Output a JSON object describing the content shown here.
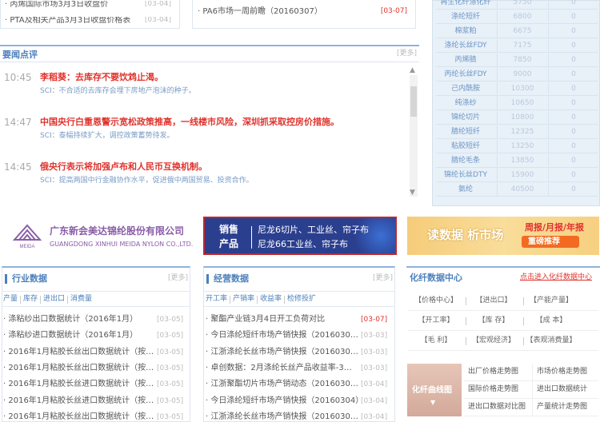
{
  "top_left_list": [
    {
      "text": "丙烯国际市场3月3日收盘价",
      "date": "[03-04]"
    },
    {
      "text": "PTA及相关产品3月3日收盘价格表",
      "date": "[03-04]"
    }
  ],
  "top_mid_list": [
    {
      "text": "PA6市场一周前瞻（20160307）",
      "date": "[03-07]"
    }
  ],
  "price_table": [
    {
      "name": "再生化纤涤化纤",
      "p": "5750",
      "c": "0"
    },
    {
      "name": "涤纶短纤",
      "p": "6800",
      "c": "0"
    },
    {
      "name": "棉浆粕",
      "p": "6675",
      "c": "0"
    },
    {
      "name": "涤纶长丝FDY",
      "p": "7175",
      "c": "0"
    },
    {
      "name": "丙烯腈",
      "p": "7850",
      "c": "0"
    },
    {
      "name": "丙纶长丝FDY",
      "p": "9000",
      "c": "0"
    },
    {
      "name": "己内酰胺",
      "p": "10300",
      "c": "0"
    },
    {
      "name": "纯涤纱",
      "p": "10650",
      "c": "0"
    },
    {
      "name": "锦纶切片",
      "p": "10800",
      "c": "0"
    },
    {
      "name": "腈纶短纤",
      "p": "12325",
      "c": "0"
    },
    {
      "name": "粘胶短纤",
      "p": "13250",
      "c": "0"
    },
    {
      "name": "腈纶毛条",
      "p": "13850",
      "c": "0"
    },
    {
      "name": "锦纶长丝DTY",
      "p": "15900",
      "c": "0"
    },
    {
      "name": "氨纶",
      "p": "40500",
      "c": "0"
    }
  ],
  "news": {
    "title": "要闻点评",
    "more": "[更多]",
    "items": [
      {
        "time": "10:45",
        "headline": "李稻葵：去库存不要饮鸩止渴。",
        "sub": "SCI：不合适的去库存会埋下房地产泡沫的种子。"
      },
      {
        "time": "14:47",
        "headline": "中国央行白重恩警示宽松政策推高，一线楼市风险，深圳抓采取控房价措施。",
        "sub": "SCI：泰幅持续扩大，调控政策蓄势待发。"
      },
      {
        "time": "14:45",
        "headline": "俄央行表示将加强卢布和人民币互换机制。",
        "sub": "SCI：提高两国中行金融协作水平，促进俄中两国贸易、投资合作。"
      }
    ]
  },
  "ads": {
    "ad1_cn": "广东新会美达锦纶股份有限公司",
    "ad1_en": "GUANGDONG XINHUI MEIDA NYLON CO.,LTD.",
    "ad1_logo_text": "MEIDA",
    "ad2_left": [
      "销售",
      "产品"
    ],
    "ad2_right": [
      "尼龙6切片、工业丝、帘子布",
      "尼龙66工业丝、帘子布"
    ],
    "ad3_left": "读数据 析市场",
    "ad3_right": "周报/月报/年报",
    "ad3_btn": "重磅推荐"
  },
  "industry": {
    "title": "行业数据",
    "more": "[更多]",
    "tabs": [
      "产量",
      "库存",
      "进出口",
      "消费量"
    ],
    "items": [
      {
        "text": "涤粘纱出口数据统计（2016年1月）",
        "date": "[03-05]"
      },
      {
        "text": "涤粘纱进口数据统计（2016年1月）",
        "date": "[03-05]"
      },
      {
        "text": "2016年1月粘胶长丝出口数据统计（按…",
        "date": "[03-05]"
      },
      {
        "text": "2016年1月粘胶长丝出口数据统计（按…",
        "date": "[03-05]"
      },
      {
        "text": "2016年1月粘胶长丝进口数据统计（按…",
        "date": "[03-05]"
      },
      {
        "text": "2016年1月粘胶长丝进口数据统计（按…",
        "date": "[03-05]"
      },
      {
        "text": "2016年1月粘胶长丝出口数据统计（按…",
        "date": "[03-05]"
      }
    ]
  },
  "business": {
    "title": "经营数据",
    "more": "[更多]",
    "tabs": [
      "开工率",
      "产销率",
      "收益率",
      "检修投扩"
    ],
    "items": [
      {
        "text": "聚酯产业链3月4日开工负荷对比",
        "date": "[03-07]",
        "red": true
      },
      {
        "text": "今日涤纶短纤市场产销快报（2016030…",
        "date": "[03-03]",
        "red": false
      },
      {
        "text": "江浙涤纶长丝市场产销快报（2016030…",
        "date": "[03-03]",
        "red": false
      },
      {
        "text": "卓创数据：2月涤纶长丝产品收益率-3…",
        "date": "[03-03]",
        "red": false
      },
      {
        "text": "江浙聚酯切片市场产销动态（2016030…",
        "date": "[03-04]",
        "red": false
      },
      {
        "text": "今日涤纶短纤市场产销快报（20160304）",
        "date": "[03-04]",
        "red": false
      },
      {
        "text": "江浙涤纶长丝市场产销快报（2016030…",
        "date": "[03-04]",
        "red": false
      }
    ]
  },
  "fiber_center": {
    "title": "化纤数据中心",
    "link": "点击进入化纤数据中心",
    "buttons": [
      "【价格中心】",
      "【进出口】",
      "【产能产量】",
      "【开工率】",
      "【库  存】",
      "【成  本】",
      "【毛  利】",
      "【宏观经济】",
      "【表观消费量】"
    ],
    "curve_label": "化纤曲线图",
    "curve_links": [
      "出厂价格走势图",
      "市场价格走势图",
      "国际价格走势图",
      "进出口数据统计",
      "进出口数据对比图",
      "产量统计走势图"
    ]
  }
}
